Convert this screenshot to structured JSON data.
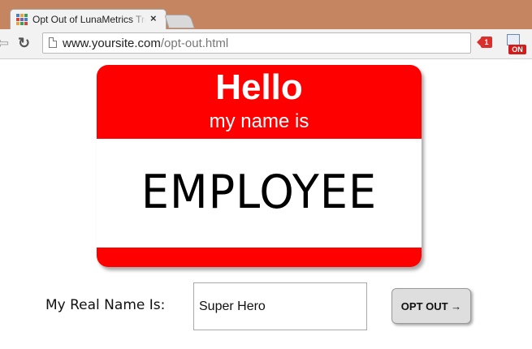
{
  "browser": {
    "tab_title": "Opt Out of LunaMetrics Tracking",
    "tab_close": "×",
    "url_host": "www.yoursite.com",
    "url_path": "/opt-out.html",
    "back_glyph": "⇦",
    "reload_glyph": "↻",
    "extension_badge": "1",
    "extension2_badge": "ON",
    "favicon_colors": [
      "#4a7fc1",
      "#e8a33b",
      "#3a9e53",
      "#d2463a",
      "#7b5fb0",
      "#4a7fc1",
      "#e8a33b",
      "#3a9e53",
      "#d2463a"
    ]
  },
  "nametag": {
    "hello": "Hello",
    "subtitle": "my name is",
    "name": "EMPLOYEE",
    "color": "#ff0000"
  },
  "form": {
    "label": "My Real Name Is:",
    "input_value": "Super Hero",
    "button_label": "OPT OUT →"
  }
}
